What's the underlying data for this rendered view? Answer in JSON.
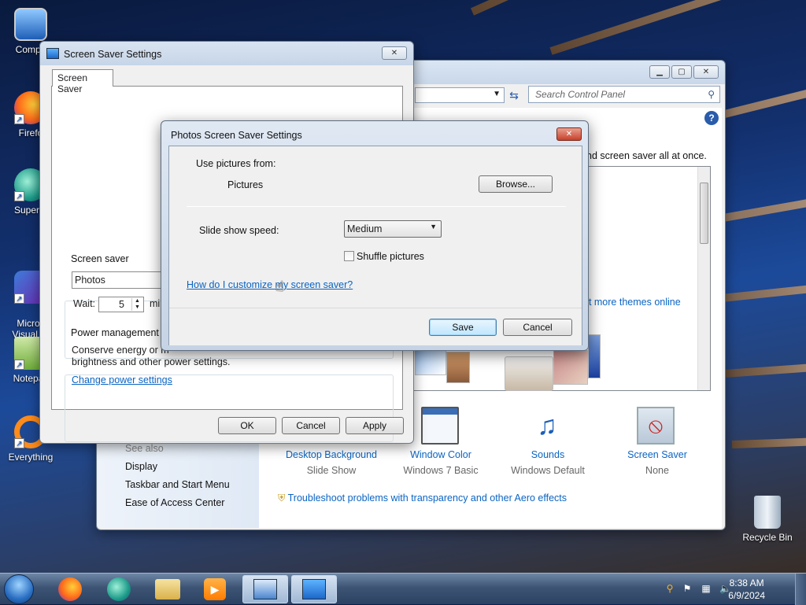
{
  "desktop": {
    "icons": [
      {
        "label": "Compu"
      },
      {
        "label": "Firefo"
      },
      {
        "label": "Superm"
      },
      {
        "label": "Micros\nVisual St"
      },
      {
        "label": "Notepac"
      },
      {
        "label": "Everything"
      },
      {
        "label": "Recycle Bin"
      }
    ]
  },
  "control_panel": {
    "search_placeholder": "Search Control Panel",
    "description_fragment": "nd screen saver all at once.",
    "more_themes": "et more themes online",
    "sidebar": {
      "see_also": "See also",
      "items": [
        "Display",
        "Taskbar and Start Menu",
        "Ease of Access Center"
      ]
    },
    "settings": [
      {
        "label": "Desktop Background",
        "value": "Slide Show"
      },
      {
        "label": "Window Color",
        "value": "Windows 7 Basic"
      },
      {
        "label": "Sounds",
        "value": "Windows Default"
      },
      {
        "label": "Screen Saver",
        "value": "None"
      }
    ],
    "troubleshoot": "Troubleshoot problems with transparency and other Aero effects"
  },
  "screen_saver_settings": {
    "title": "Screen Saver Settings",
    "tab": "Screen Saver",
    "group_screensaver": "Screen saver",
    "selected_saver": "Photos",
    "wait_label": "Wait:",
    "wait_value": "5",
    "minutes_fragment": "mi",
    "group_power": "Power management",
    "power_text_line1": "Conserve energy or m",
    "power_text_line2": "brightness and other power settings.",
    "power_link": "Change power settings",
    "ok": "OK",
    "cancel": "Cancel",
    "apply": "Apply"
  },
  "photos_dialog": {
    "title": "Photos Screen Saver Settings",
    "use_pictures_from": "Use pictures from:",
    "source": "Pictures",
    "browse": "Browse...",
    "speed_label": "Slide show speed:",
    "speed_value": "Medium",
    "shuffle_label": "Shuffle pictures",
    "shuffle_checked": false,
    "help_link": "How do I customize my screen saver?",
    "save": "Save",
    "cancel": "Cancel"
  },
  "taskbar": {
    "time": "8:38 AM",
    "date": "6/9/2024"
  }
}
